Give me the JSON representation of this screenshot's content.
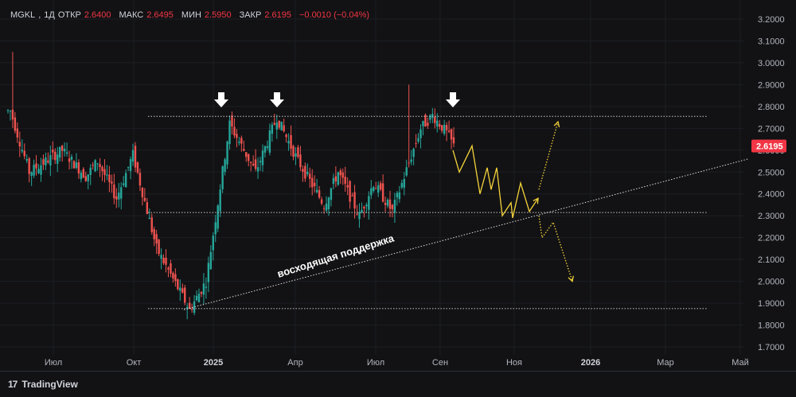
{
  "legend": {
    "symbol": "MGKL",
    "interval": "1Д",
    "open_label": "ОТКР",
    "open": "2.6400",
    "high_label": "МАКС",
    "high": "2.6495",
    "low_label": "МИН",
    "low": "2.5950",
    "close_label": "ЗАКР",
    "close": "2.6195",
    "change": "−0.0010 (−0.04%)"
  },
  "price_tag": "2.6195",
  "brand": {
    "logo_text": "17",
    "name": "TradingView"
  },
  "colors": {
    "up": "#26a69a",
    "down": "#ef5350",
    "forecast": "#f5d33a",
    "tag": "#f23645",
    "level": "#c8c8c8"
  },
  "chart_data": {
    "type": "candlestick",
    "y_axis": {
      "min": 1.65,
      "max": 3.25,
      "ticks": [
        "3.2000",
        "3.1000",
        "3.0000",
        "2.9000",
        "2.8000",
        "2.7000",
        "2.6000",
        "2.5000",
        "2.4000",
        "2.3000",
        "2.2000",
        "2.1000",
        "2.0000",
        "1.9000",
        "1.8000",
        "1.7000"
      ]
    },
    "x_axis": {
      "ticks": [
        "Июл",
        "Окт",
        "2025",
        "Апр",
        "Июл",
        "Сен",
        "Ноя",
        "2026",
        "Мар",
        "Май"
      ],
      "bold_ticks": [
        "2025",
        "2026"
      ]
    },
    "series": [
      {
        "name": "MGKL",
        "segments": [
          {
            "from": 0,
            "to": 2.78,
            "pts": 2
          },
          {
            "from": 2.78,
            "to": 2.5,
            "pts": 8
          },
          {
            "from": 2.5,
            "to": 2.6,
            "pts": 14
          },
          {
            "from": 2.6,
            "to": 2.48,
            "pts": 10
          },
          {
            "from": 2.48,
            "to": 2.55,
            "pts": 5
          },
          {
            "from": 2.55,
            "to": 2.38,
            "pts": 8
          },
          {
            "from": 2.38,
            "to": 2.58,
            "pts": 7
          },
          {
            "from": 2.58,
            "to": 2.15,
            "pts": 10
          },
          {
            "from": 2.15,
            "to": 1.87,
            "pts": 14
          },
          {
            "from": 1.87,
            "to": 2.0,
            "pts": 7
          },
          {
            "from": 2.0,
            "to": 2.72,
            "pts": 10
          },
          {
            "from": 2.72,
            "to": 2.5,
            "pts": 11
          },
          {
            "from": 2.5,
            "to": 2.75,
            "pts": 9
          },
          {
            "from": 2.75,
            "to": 2.55,
            "pts": 9
          },
          {
            "from": 2.55,
            "to": 2.35,
            "pts": 11
          },
          {
            "from": 2.35,
            "to": 2.5,
            "pts": 6
          },
          {
            "from": 2.5,
            "to": 2.3,
            "pts": 9
          },
          {
            "from": 2.3,
            "to": 2.45,
            "pts": 6
          },
          {
            "from": 2.45,
            "to": 2.32,
            "pts": 8
          },
          {
            "from": 2.32,
            "to": 2.7,
            "pts": 12
          },
          {
            "from": 2.7,
            "to": 2.76,
            "pts": 5
          },
          {
            "from": 2.76,
            "to": 2.68,
            "pts": 6
          },
          {
            "from": 2.68,
            "to": 2.62,
            "pts": 3
          }
        ]
      }
    ],
    "levels": [
      {
        "name": "resistance",
        "value": 2.755
      },
      {
        "name": "middle",
        "value": 2.315
      },
      {
        "name": "low",
        "value": 1.875
      }
    ],
    "trendline": {
      "label": "восходящая поддержка",
      "from": [
        0.231,
        1.87
      ],
      "to": [
        0.94,
        2.56
      ]
    },
    "markers": [
      {
        "icon": "down-arrow-icon",
        "x": 0.278,
        "y": 2.79
      },
      {
        "icon": "down-arrow-icon",
        "x": 0.348,
        "y": 2.79
      },
      {
        "icon": "down-arrow-icon",
        "x": 0.569,
        "y": 2.79
      }
    ],
    "forecast_main": [
      [
        0.569,
        2.6
      ],
      [
        0.577,
        2.5
      ],
      [
        0.593,
        2.62
      ],
      [
        0.603,
        2.4
      ],
      [
        0.612,
        2.52
      ],
      [
        0.617,
        2.42
      ],
      [
        0.624,
        2.52
      ],
      [
        0.631,
        2.3
      ],
      [
        0.642,
        2.36
      ],
      [
        0.644,
        2.29
      ],
      [
        0.654,
        2.45
      ],
      [
        0.665,
        2.32
      ],
      [
        0.676,
        2.38
      ]
    ],
    "forecast_up": [
      [
        0.677,
        2.42
      ],
      [
        0.701,
        2.73
      ]
    ],
    "forecast_down": [
      [
        0.677,
        2.3
      ],
      [
        0.681,
        2.2
      ],
      [
        0.695,
        2.27
      ],
      [
        0.719,
        2.0
      ]
    ]
  }
}
